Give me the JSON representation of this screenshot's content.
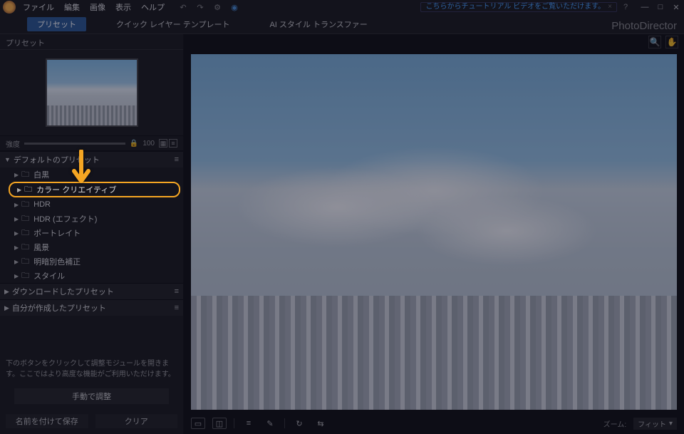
{
  "menubar": {
    "items": [
      "ファイル",
      "編集",
      "画像",
      "表示",
      "ヘルプ"
    ],
    "tutorial_text": "こちらからチュートリアル ビデオをご覧いただけます。",
    "window_controls": {
      "min": "—",
      "max": "□",
      "close": "✕"
    }
  },
  "tabbar": {
    "active": "プリセット",
    "tabs": [
      "クイック レイヤー テンプレート",
      "AI スタイル トランスファー"
    ],
    "brand": "PhotoDirector"
  },
  "sidebar": {
    "panel_title": "プリセット",
    "strength_label": "強度",
    "strength_value": "100",
    "sections": [
      {
        "title": "デフォルトのプリセット",
        "expanded": true,
        "items": [
          {
            "label": "白黒"
          },
          {
            "label": "カラー クリエイティブ",
            "highlighted": true
          },
          {
            "label": "HDR"
          },
          {
            "label": "HDR (エフェクト)"
          },
          {
            "label": "ポートレイト"
          },
          {
            "label": "風景"
          },
          {
            "label": "明暗別色補正"
          },
          {
            "label": "スタイル"
          }
        ]
      },
      {
        "title": "ダウンロードしたプリセット",
        "expanded": false
      },
      {
        "title": "自分が作成したプリセット",
        "expanded": false
      }
    ],
    "hint_text": "下のボタンをクリックして調整モジュールを開きます。ここではより高度な機能がご利用いただけます。",
    "manual_button": "手動で調整",
    "save_button": "名前を付けて保存",
    "clear_button": "クリア"
  },
  "footer": {
    "zoom_label": "ズーム:",
    "zoom_value": "フィット"
  },
  "icons": {
    "undo": "↶",
    "redo": "↷",
    "gear": "⚙",
    "bell": "◉",
    "search": "🔍",
    "hand": "✋",
    "triangle_down": "▼",
    "triangle_right": "▶",
    "folder": "🗀",
    "grid": "▦",
    "list": "≡",
    "hamburger": "≡",
    "single_view": "▭",
    "compare_view": "◫",
    "levels": "≡",
    "brush": "✎",
    "rotate": "↻",
    "sliders": "⇆",
    "dropdown": "▾",
    "help": "?",
    "close_small": "×",
    "lock": "🔒"
  }
}
